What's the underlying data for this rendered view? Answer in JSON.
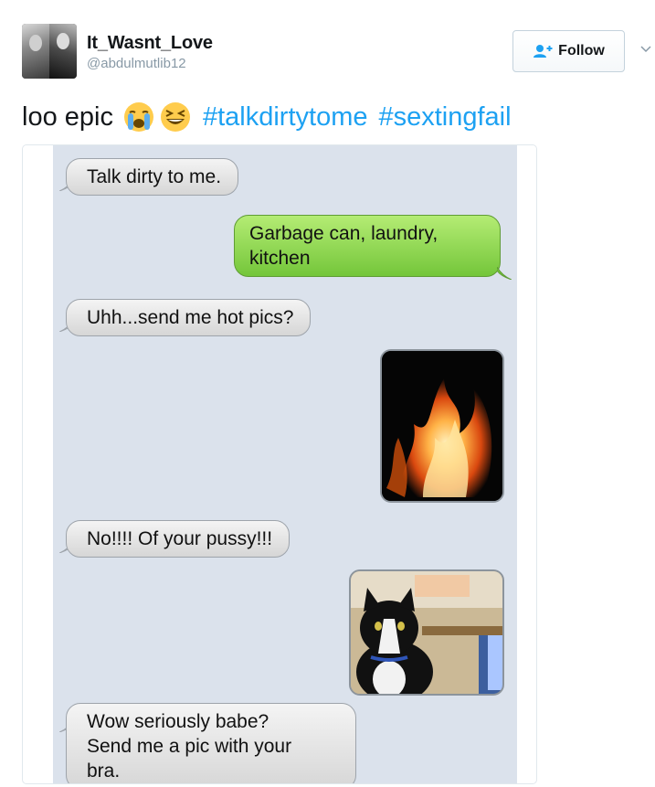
{
  "tweet": {
    "display_name": "It_Wasnt_Love",
    "handle": "@abdulmutlib12",
    "follow_label": "Follow",
    "text_plain": "loo epic",
    "emojis": [
      "loudly-crying-face-emoji",
      "grinning-squinting-face-emoji"
    ],
    "hashtags": [
      "#talkdirtytome",
      "#sextingfail"
    ]
  },
  "chat": {
    "messages": [
      {
        "side": "in",
        "text": "Talk dirty to me."
      },
      {
        "side": "out",
        "lines": [
          "Garbage can, laundry,",
          "kitchen"
        ]
      },
      {
        "side": "in",
        "text": "Uhh...send me hot pics?"
      },
      {
        "side": "out",
        "image": "fire-photo"
      },
      {
        "side": "in",
        "text": "No!!!! Of your pussy!!!"
      },
      {
        "side": "out",
        "image": "cat-photo"
      },
      {
        "side": "in",
        "lines": [
          "Wow seriously babe?",
          "Send me a pic with your",
          "bra."
        ]
      }
    ]
  },
  "colors": {
    "hashtag": "#1da1f2",
    "handle": "#8899a6",
    "chat_background": "#dbe2ec",
    "outgoing_bubble": "#8bd449",
    "incoming_bubble": "#e6e6e6"
  }
}
